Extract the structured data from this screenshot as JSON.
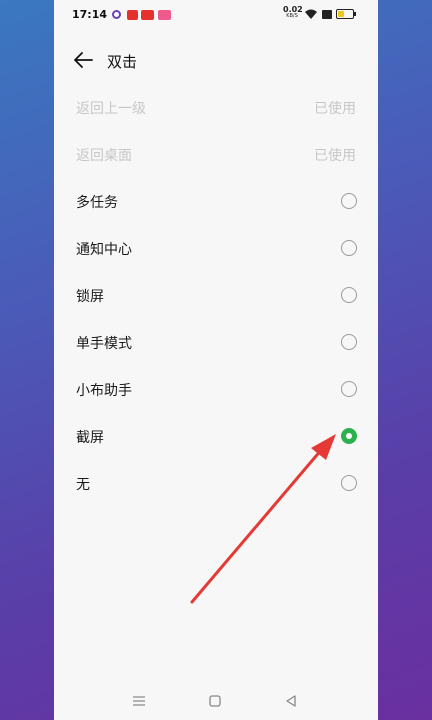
{
  "status_bar": {
    "time": "17:14",
    "net_speed": "0.02",
    "net_unit": "KB/S",
    "battery_level": 0.45
  },
  "header": {
    "title": "双击"
  },
  "options": [
    {
      "label": "返回上一级",
      "status": "已使用",
      "disabled": true
    },
    {
      "label": "返回桌面",
      "status": "已使用",
      "disabled": true
    },
    {
      "label": "多任务",
      "selected": false
    },
    {
      "label": "通知中心",
      "selected": false
    },
    {
      "label": "锁屏",
      "selected": false
    },
    {
      "label": "单手模式",
      "selected": false
    },
    {
      "label": "小布助手",
      "selected": false
    },
    {
      "label": "截屏",
      "selected": true
    },
    {
      "label": "无",
      "selected": false
    }
  ],
  "colors": {
    "accent": "#2bb24c",
    "annotation_arrow": "#e53935"
  },
  "icons": {
    "back": "arrow-left-icon",
    "nav_menu": "menu-lines-icon",
    "nav_home": "square-icon",
    "nav_back": "triangle-back-icon"
  }
}
